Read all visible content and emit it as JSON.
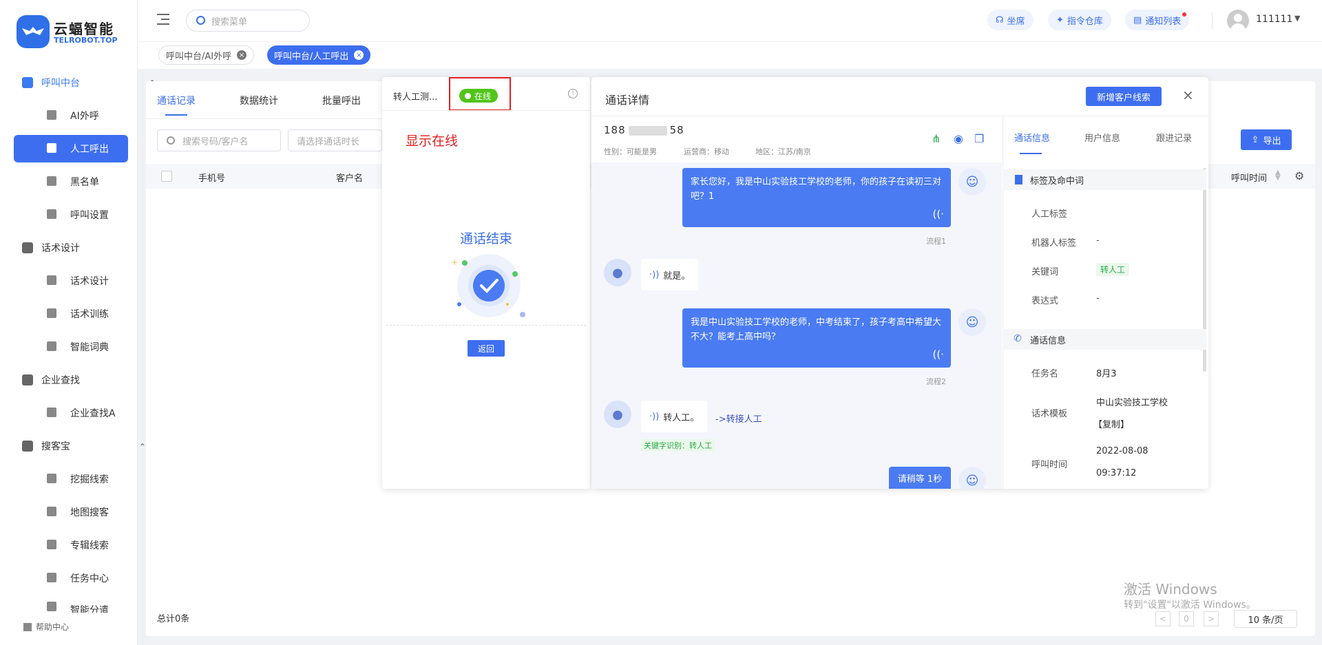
{
  "sidebar": {
    "logo": {
      "title": "云蝠智能",
      "subtitle": "TELROBOT.TOP"
    },
    "groups": [
      {
        "label": "呼叫中台",
        "items": [
          "AI外呼",
          "人工呼出",
          "黑名单",
          "呼叫设置"
        ]
      },
      {
        "label": "话术设计",
        "items": [
          "话术设计",
          "话术训练",
          "智能词典"
        ]
      },
      {
        "label": "企业查找",
        "items": [
          "企业查找A"
        ]
      },
      {
        "label": "搜客宝",
        "items": [
          "挖掘线索",
          "地图搜客",
          "专辑线索",
          "任务中心",
          "智能分遣"
        ]
      }
    ],
    "help": "帮助中心"
  },
  "header": {
    "search_placeholder": "搜索菜单",
    "pills": [
      "坐席",
      "指令仓库",
      "通知列表"
    ],
    "username": "111111"
  },
  "page_tabs": [
    "呼叫中台/AI外呼",
    "呼叫中台/人工呼出"
  ],
  "main": {
    "tabs": [
      "通话记录",
      "数据统计",
      "批量呼出"
    ],
    "search_placeholder": "搜索号码/客户名",
    "duration_placeholder": "请选择通话时长",
    "columns": [
      "手机号",
      "客户名",
      "呼叫时间"
    ],
    "export": "导出",
    "total": "总计0条",
    "page": "0",
    "page_size": "10 条/页"
  },
  "call_panel": {
    "name": "转人工测...",
    "status": "在线",
    "annotation": "显示在线",
    "ended": "通话结束",
    "back": "返回"
  },
  "detail": {
    "title": "通话详情",
    "new_lead": "新增客户线索",
    "phone": "188 58",
    "gender": "性别：可能是男",
    "carrier": "运营商：移动",
    "region": "地区：江苏/南京",
    "messages": [
      {
        "role": "bot",
        "text": "家长您好，我是中山实验技工学校的老师，你的孩子在读初三对吧？1",
        "tag": "流程1"
      },
      {
        "role": "user",
        "text": "就是。"
      },
      {
        "role": "bot",
        "text": "我是中山实验技工学校的老师，中考结束了，孩子考高中希望大不大？能考上高中吗？",
        "tag": "流程2"
      },
      {
        "role": "user",
        "text": "转人工。",
        "note": "->转接人工",
        "keyword": "关键字识别：转人工"
      },
      {
        "role": "bot",
        "text": "请稍等 1秒"
      }
    ],
    "info_tabs": [
      "通话信息",
      "用户信息",
      "跟进记录"
    ],
    "sec1": "标签及命中词",
    "fields1": [
      {
        "k": "人工标签",
        "v": ""
      },
      {
        "k": "机器人标签",
        "v": "-"
      },
      {
        "k": "关键词",
        "v": "转人工"
      },
      {
        "k": "表达式",
        "v": "-"
      }
    ],
    "sec2": "通话信息",
    "task_k": "任务名",
    "task_v": "8月3",
    "tpl_k": "话术模板",
    "tpl_v": "中山实验技工学校",
    "tpl_copy": "【复制】",
    "time_k": "呼叫时间",
    "time_v1": "2022-08-08",
    "time_v2": "09:37:12"
  },
  "watermark": {
    "line1": "激活 Windows",
    "line2": "转到\"设置\"以激活 Windows。"
  }
}
